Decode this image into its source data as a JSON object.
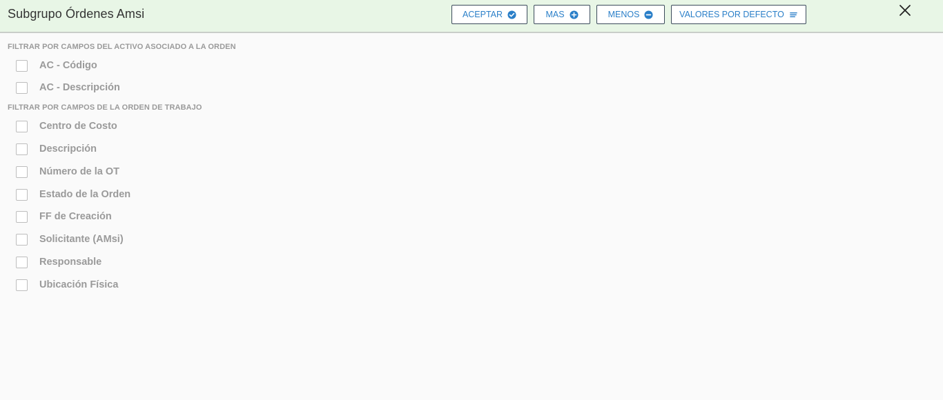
{
  "header": {
    "title": "Subgrupo Órdenes Amsi",
    "buttons": {
      "aceptar": "ACEPTAR",
      "mas": "MAS",
      "menos": "MENOS",
      "valores_por_defecto": "VALORES POR DEFECTO"
    },
    "close_icon": "close-icon"
  },
  "sections": [
    {
      "label": "FILTRAR POR CAMPOS DEL ACTIVO ASOCIADO A LA ORDEN",
      "items": [
        {
          "label": "AC - Código",
          "checked": false
        },
        {
          "label": "AC - Descripción",
          "checked": false
        }
      ]
    },
    {
      "label": "FILTRAR POR CAMPOS DE LA ORDEN DE TRABAJO",
      "items": [
        {
          "label": "Centro de Costo",
          "checked": false
        },
        {
          "label": "Descripción",
          "checked": false
        },
        {
          "label": "Número de la OT",
          "checked": false
        },
        {
          "label": "Estado de la Orden",
          "checked": false
        },
        {
          "label": "FF de Creación",
          "checked": false
        },
        {
          "label": "Solicitante (AMsi)",
          "checked": false
        },
        {
          "label": "Responsable",
          "checked": false
        },
        {
          "label": "Ubicación Física",
          "checked": false
        }
      ]
    }
  ],
  "colors": {
    "header_bg": "#e8f6e6",
    "accent": "#2a7fc8",
    "muted_text": "#9a9a9a"
  }
}
